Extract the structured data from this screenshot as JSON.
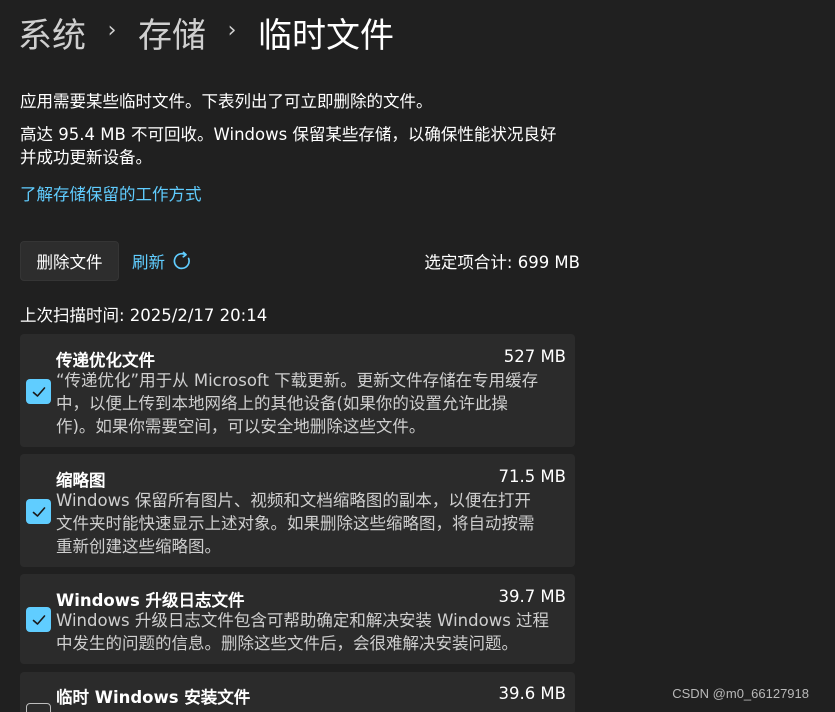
{
  "breadcrumb": {
    "items": [
      "系统",
      "存储"
    ],
    "current": "临时文件",
    "separator": "›"
  },
  "description": {
    "line1": "应用需要某些临时文件。下表列出了可立即删除的文件。",
    "line2a": "高达 95.4 MB 不可回收。Windows 保留某些存储，以确保性能状况良好",
    "line2b": "并成功更新设备。",
    "link": "了解存储保留的工作方式"
  },
  "actions": {
    "delete_label": "删除文件",
    "refresh_label": "刷新",
    "total_label": "选定项合计: 699 MB"
  },
  "scan_time": "上次扫描时间: 2025/2/17 20:14",
  "items": [
    {
      "title": "传递优化文件",
      "size": "527 MB",
      "checked": true,
      "lines": [
        "“传递优化”用于从 Microsoft 下载更新。更新文件存储在专用缓存",
        "中，以便上传到本地网络上的其他设备(如果你的设置允许此操",
        "作)。如果你需要空间，可以安全地删除这些文件。"
      ]
    },
    {
      "title": "缩略图",
      "size": "71.5 MB",
      "checked": true,
      "lines": [
        "Windows 保留所有图片、视频和文档缩略图的副本，以便在打开",
        "文件夹时能快速显示上述对象。如果删除这些缩略图，将自动按需",
        "重新创建这些缩略图。"
      ]
    },
    {
      "title": "Windows 升级日志文件",
      "size": "39.7 MB",
      "checked": true,
      "lines": [
        "Windows 升级日志文件包含可帮助确定和解决安装 Windows 过程",
        "中发生的问题的信息。删除这些文件后，会很难解决安装问题。"
      ]
    },
    {
      "title": "临时 Windows 安装文件",
      "size": "39.6 MB",
      "checked": false,
      "lines": []
    }
  ],
  "watermark": "CSDN @m0_66127918",
  "colors": {
    "background": "#202020",
    "card": "#2b2b2b",
    "accent": "#60cdff",
    "secondary_text": "#cfcfcf"
  }
}
